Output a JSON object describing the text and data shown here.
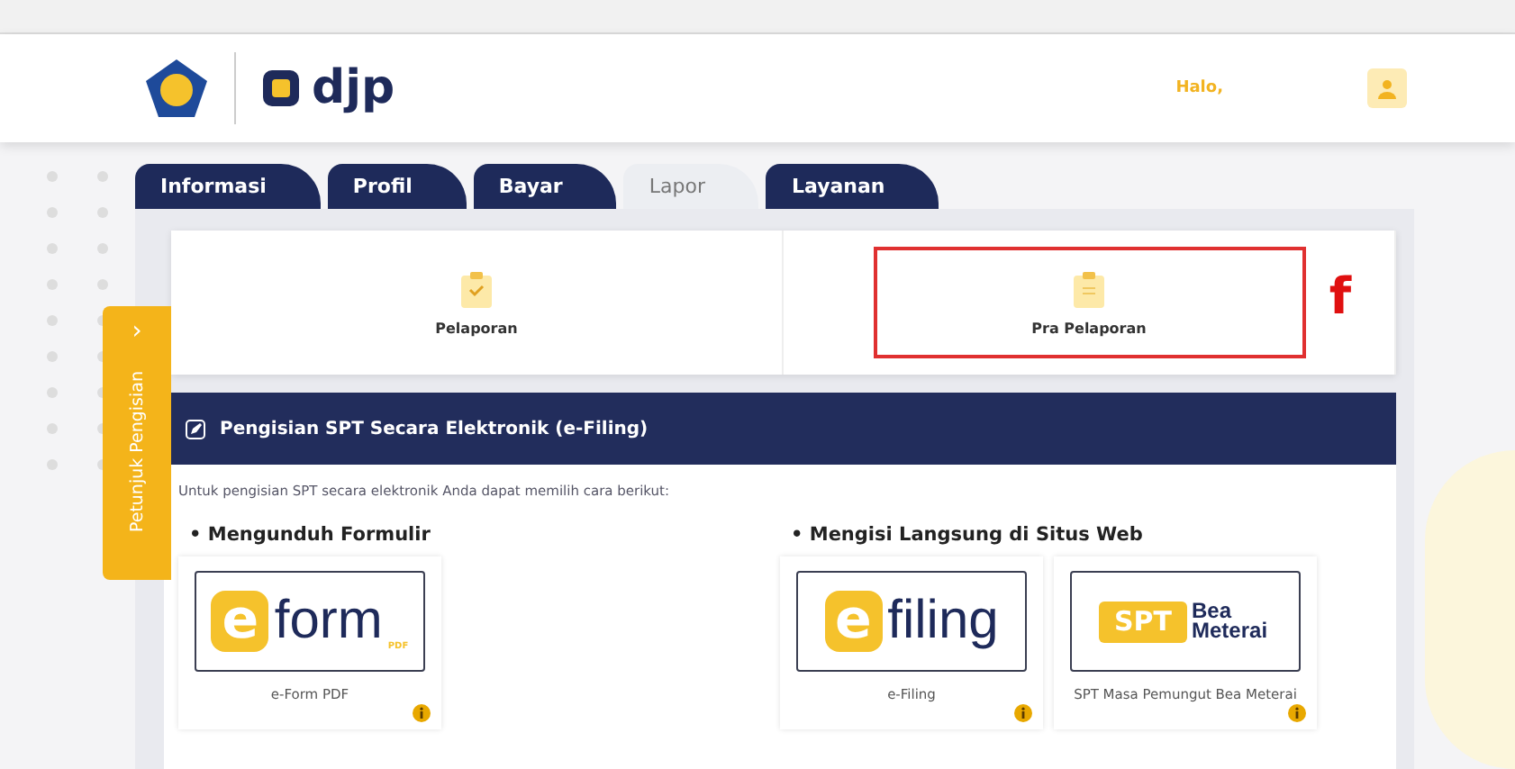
{
  "header": {
    "logo_text": "djp",
    "greeting": "Halo,"
  },
  "side_tab": {
    "arrow": "›",
    "label": "Petunjuk Pengisian"
  },
  "tabs": [
    {
      "label": "Informasi",
      "selected": false
    },
    {
      "label": "Profil",
      "selected": false
    },
    {
      "label": "Bayar",
      "selected": false
    },
    {
      "label": "Lapor",
      "selected": true
    },
    {
      "label": "Layanan",
      "selected": false
    }
  ],
  "report_options": [
    {
      "label": "Pelaporan",
      "kind": "check",
      "highlighted": false
    },
    {
      "label": "Pra Pelaporan",
      "kind": "lines",
      "highlighted": true,
      "annotation": "f"
    }
  ],
  "section": {
    "title": "Pengisian SPT Secara Elektronik (e-Filing)",
    "intro": "Untuk pengisian SPT secara elektronik Anda dapat memilih cara berikut:",
    "groups": [
      {
        "title": "• Mengunduh Formulir",
        "items": [
          {
            "kind": "eform",
            "mark": "e",
            "word": "form",
            "sub": "PDF",
            "label": "e-Form PDF"
          }
        ]
      },
      {
        "title": "• Mengisi Langsung di Situs Web",
        "items": [
          {
            "kind": "efiling",
            "mark": "e",
            "word": "filing",
            "label": "e-Filing"
          },
          {
            "kind": "spt",
            "mark": "SPT",
            "word": "Bea Meterai",
            "label": "SPT Masa Pemungut Bea Meterai"
          }
        ]
      }
    ]
  }
}
